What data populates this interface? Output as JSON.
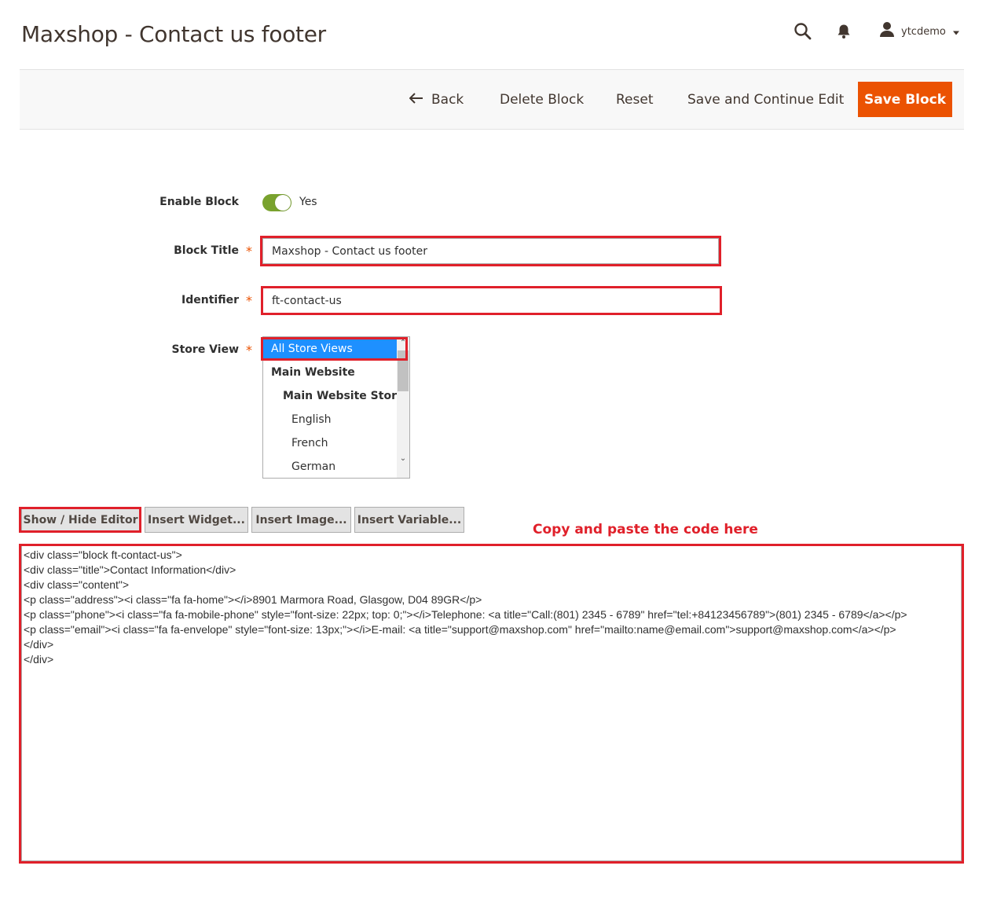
{
  "page": {
    "title": "Maxshop - Contact us footer"
  },
  "header": {
    "user": {
      "name": "ytcdemo"
    }
  },
  "actions": {
    "back": "Back",
    "delete": "Delete Block",
    "reset": "Reset",
    "save_continue": "Save and Continue Edit",
    "save": "Save Block"
  },
  "form": {
    "enable": {
      "label": "Enable Block",
      "value": "Yes",
      "on": true
    },
    "title": {
      "label": "Block Title",
      "value": "Maxshop - Contact us footer"
    },
    "identifier": {
      "label": "Identifier",
      "value": "ft-contact-us"
    },
    "store_view": {
      "label": "Store View",
      "options": [
        {
          "label": "All Store Views",
          "selected": true
        },
        {
          "label": "Main Website"
        },
        {
          "label": "Main Website Store"
        },
        {
          "label": "English"
        },
        {
          "label": "French"
        },
        {
          "label": "German"
        }
      ]
    },
    "required_mark": "*"
  },
  "editor": {
    "show_hide": "Show / Hide Editor",
    "insert_widget": "Insert Widget...",
    "insert_image": "Insert Image...",
    "insert_variable": "Insert Variable...",
    "annotation": "Copy and paste the code here",
    "content": "<div class=\"block ft-contact-us\">\n<div class=\"title\">Contact Information</div>\n<div class=\"content\">\n<p class=\"address\"><i class=\"fa fa-home\"></i>8901 Marmora Road, Glasgow, D04 89GR</p>\n<p class=\"phone\"><i class=\"fa fa-mobile-phone\" style=\"font-size: 22px; top: 0;\"></i>Telephone: <a title=\"Call:(801) 2345 - 6789\" href=\"tel:+84123456789\">(801) 2345 - 6789</a></p>\n<p class=\"email\"><i class=\"fa fa-envelope\" style=\"font-size: 13px;\"></i>E-mail: <a title=\"support@maxshop.com\" href=\"mailto:name@email.com\">support@maxshop.com</a></p>\n</div>\n</div>"
  },
  "colors": {
    "accent": "#eb5202",
    "toggle_on": "#79a22e",
    "highlight": "#e0202a",
    "selected": "#1e90ff"
  },
  "icons": [
    "search-icon",
    "bell-icon",
    "user-icon",
    "chevron-down-icon",
    "arrow-left-icon"
  ]
}
